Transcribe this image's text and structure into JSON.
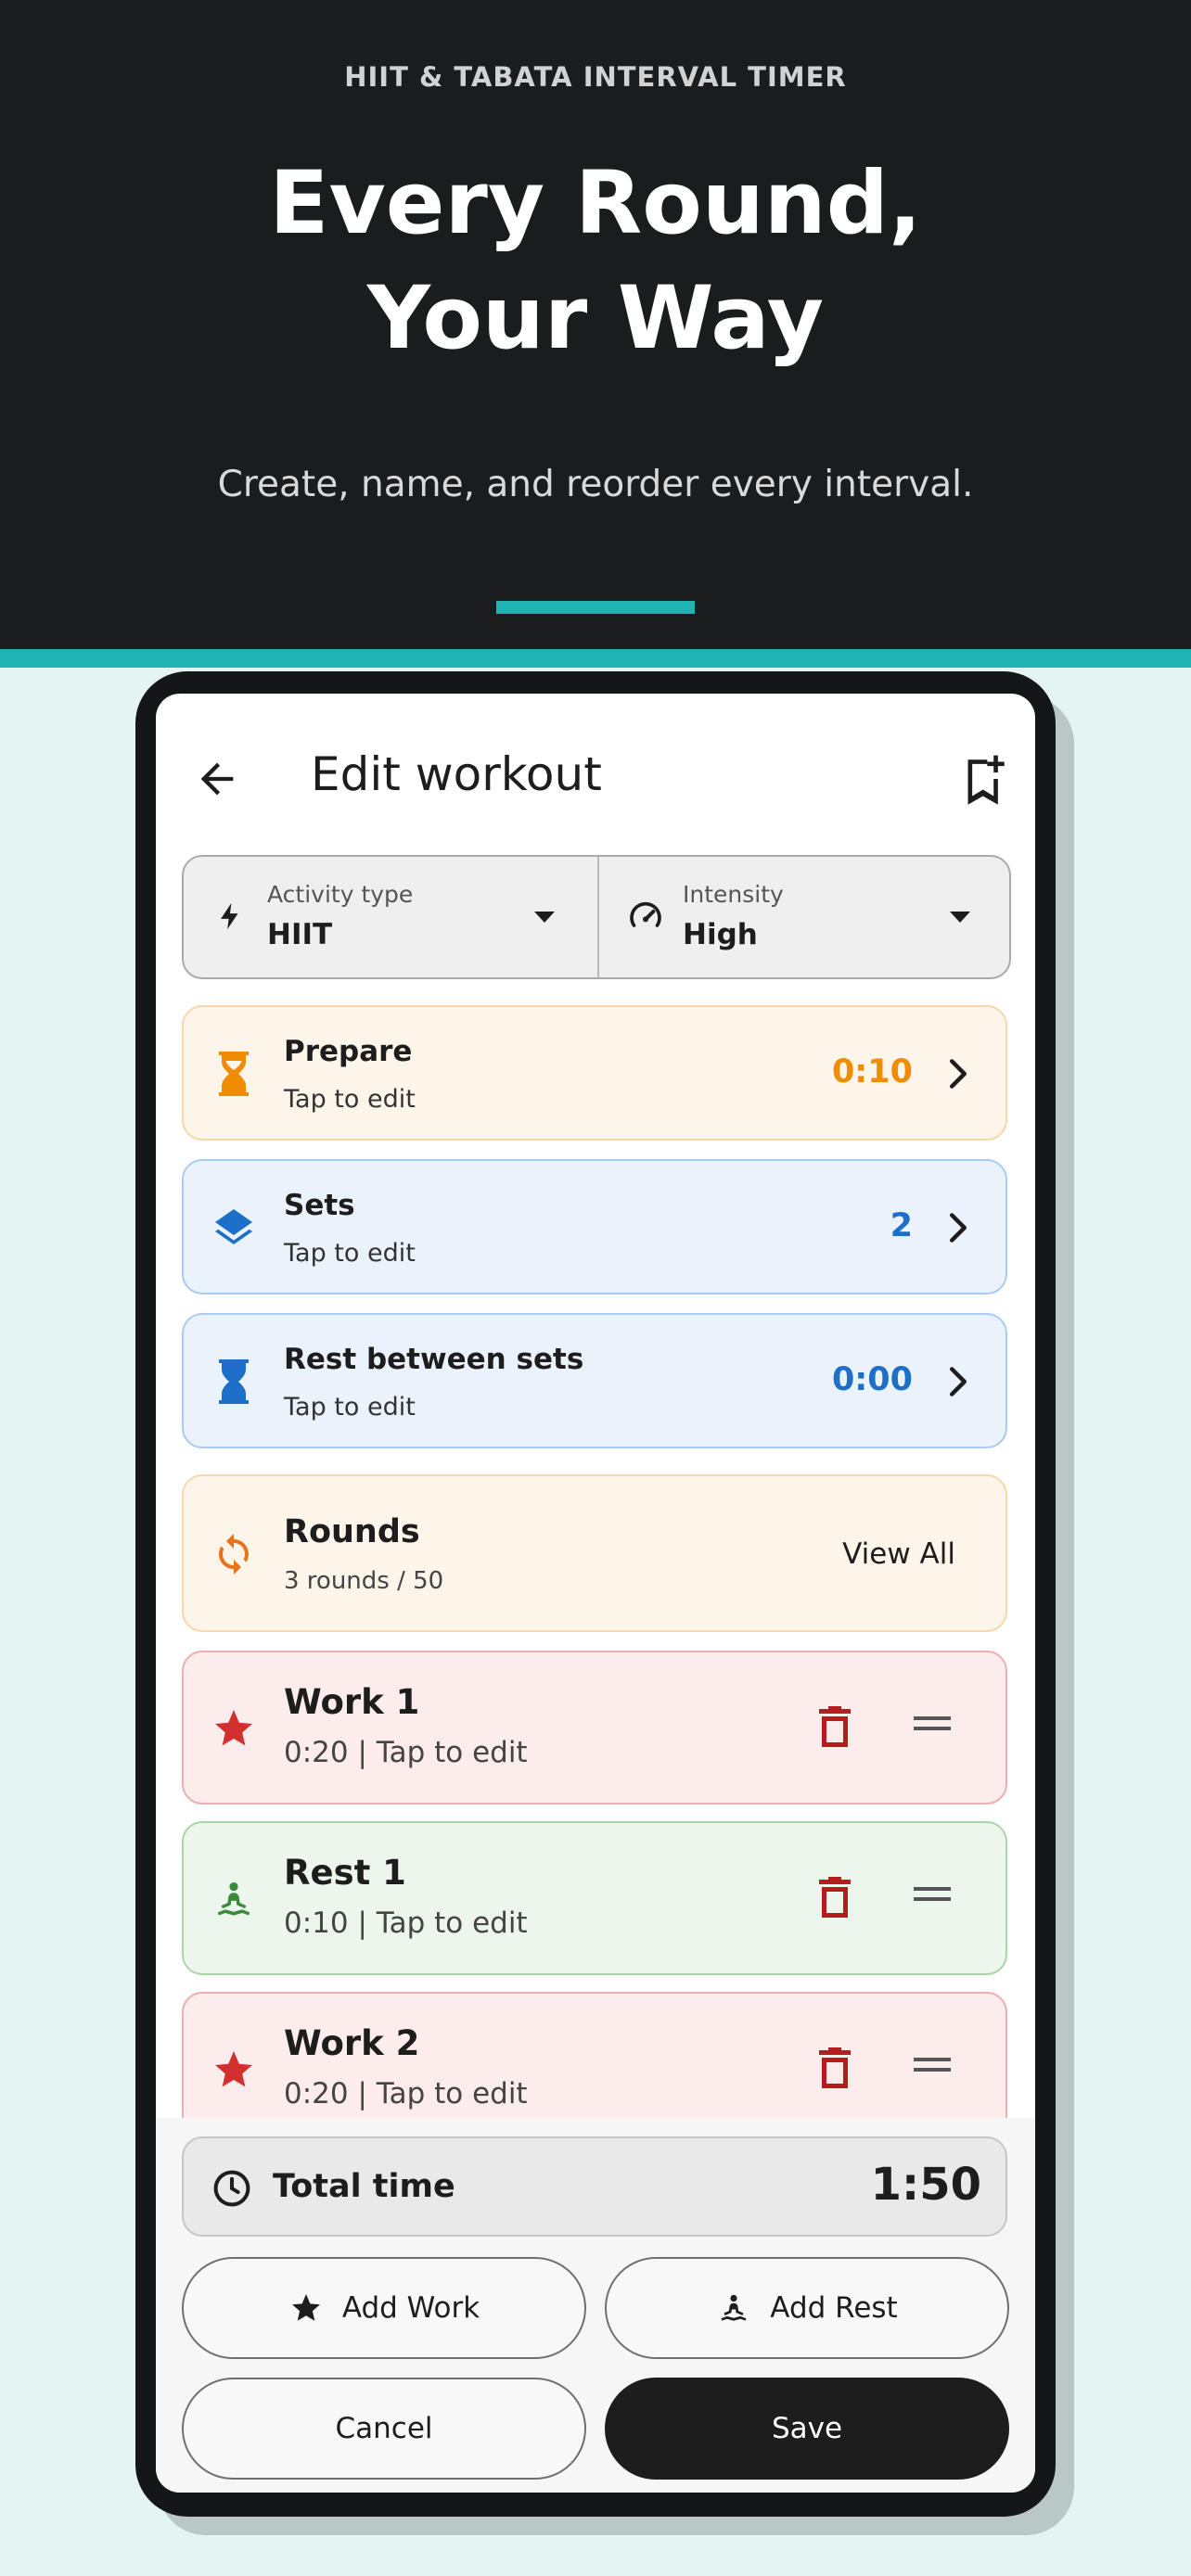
{
  "hero": {
    "eyebrow": "HIIT & TABATA INTERVAL TIMER",
    "headline_line1": "Every Round,",
    "headline_line2": "Your Way",
    "subhead": "Create, name, and reorder every interval."
  },
  "appbar": {
    "title": "Edit workout",
    "back_icon": "arrow-left-icon",
    "save_preset_icon": "bookmark-add-icon"
  },
  "dropdowns": {
    "activity": {
      "label": "Activity type",
      "value": "HIIT",
      "icon": "bolt-icon"
    },
    "intensity": {
      "label": "Intensity",
      "value": "High",
      "icon": "speedometer-icon"
    }
  },
  "settings": [
    {
      "title": "Prepare",
      "sub": "Tap to edit",
      "value": "0:10",
      "color": "#f08c00",
      "icon": "hourglass-icon"
    },
    {
      "title": "Sets",
      "sub": "Tap to edit",
      "value": "2",
      "color": "#1e6fc8",
      "icon": "layers-icon"
    },
    {
      "title": "Rest between sets",
      "sub": "Tap to edit",
      "value": "0:00",
      "color": "#1e6fc8",
      "icon": "hourglass-icon"
    }
  ],
  "rounds": {
    "title": "Rounds",
    "sub": "3 rounds / 50",
    "action": "View All",
    "icon": "repeat-icon"
  },
  "intervals": [
    {
      "title": "Work 1",
      "sub": "0:20 | Tap to edit",
      "kind": "work",
      "icon": "star-icon"
    },
    {
      "title": "Rest 1",
      "sub": "0:10 | Tap to edit",
      "kind": "rest",
      "icon": "meditation-icon"
    },
    {
      "title": "Work 2",
      "sub": "0:20 | Tap to edit",
      "kind": "work",
      "icon": "star-icon"
    }
  ],
  "total": {
    "label": "Total time",
    "value": "1:50",
    "icon": "clock-icon"
  },
  "buttons": {
    "add_work": "Add Work",
    "add_rest": "Add Rest",
    "cancel": "Cancel",
    "save": "Save"
  },
  "colors": {
    "hero_bg": "#1b1c1e",
    "accent": "#1fb3b3",
    "work_red": "#d32f2f",
    "rest_green": "#3a8a3a",
    "trash_red": "#b71c1c"
  }
}
